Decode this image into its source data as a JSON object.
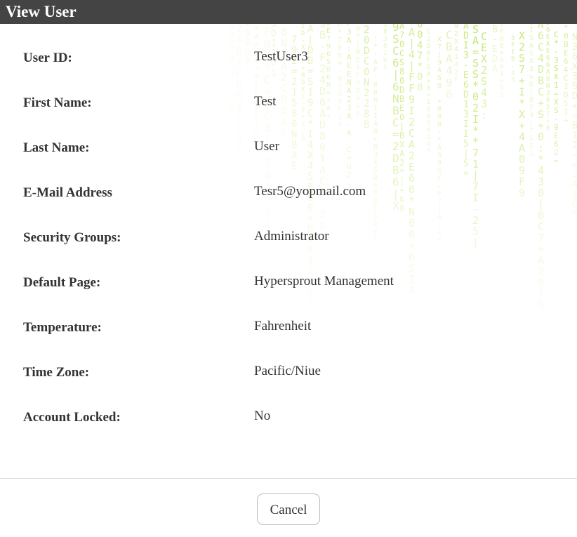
{
  "dialog": {
    "title": "View User"
  },
  "fields": [
    {
      "label": "User ID:",
      "value": "TestUser3"
    },
    {
      "label": "First Name:",
      "value": "Test"
    },
    {
      "label": "Last Name:",
      "value": "User"
    },
    {
      "label": "E-Mail Address",
      "value": "Tesr5@yopmail.com"
    },
    {
      "label": "Security Groups:",
      "value": "Administrator"
    },
    {
      "label": "Default Page:",
      "value": "Hypersprout Management"
    },
    {
      "label": "Temperature:",
      "value": "Fahrenheit"
    },
    {
      "label": "Time Zone:",
      "value": "Pacific/Niue"
    },
    {
      "label": "Account Locked:",
      "value": "No"
    }
  ],
  "footer": {
    "cancel_label": "Cancel"
  },
  "colors": {
    "titlebar": "#444444",
    "matrix_green": "#aee54a"
  }
}
